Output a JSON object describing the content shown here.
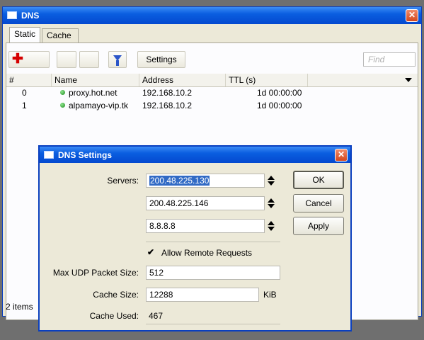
{
  "main_window": {
    "title": "DNS",
    "tabs": [
      {
        "label": "Static",
        "active": true
      },
      {
        "label": "Cache",
        "active": false
      }
    ],
    "toolbar": {
      "add_icon": "plus-icon",
      "filter_icon": "filter-icon",
      "settings_label": "Settings",
      "find_placeholder": "Find"
    },
    "table": {
      "columns": [
        "#",
        "Name",
        "Address",
        "TTL (s)"
      ],
      "rows": [
        {
          "num": "0",
          "name": "proxy.hot.net",
          "address": "192.168.10.2",
          "ttl": "1d 00:00:00"
        },
        {
          "num": "1",
          "name": "alpamayo-vip.tk",
          "address": "192.168.10.2",
          "ttl": "1d 00:00:00"
        }
      ]
    },
    "status": "2 items"
  },
  "dns_settings": {
    "title": "DNS Settings",
    "servers_label": "Servers:",
    "servers": [
      "200.48.225.130",
      "200.48.225.146",
      "8.8.8.8"
    ],
    "allow_remote_label": "Allow Remote Requests",
    "allow_remote_checked": true,
    "max_udp_label": "Max UDP Packet Size:",
    "max_udp_value": "512",
    "cache_size_label": "Cache Size:",
    "cache_size_value": "12288",
    "cache_size_unit": "KiB",
    "cache_used_label": "Cache Used:",
    "cache_used_value": "467",
    "buttons": {
      "ok": "OK",
      "cancel": "Cancel",
      "apply": "Apply"
    }
  },
  "colors": {
    "titlebar": "#0a5ee0",
    "selection": "#316ac5",
    "close": "#d3471c"
  }
}
